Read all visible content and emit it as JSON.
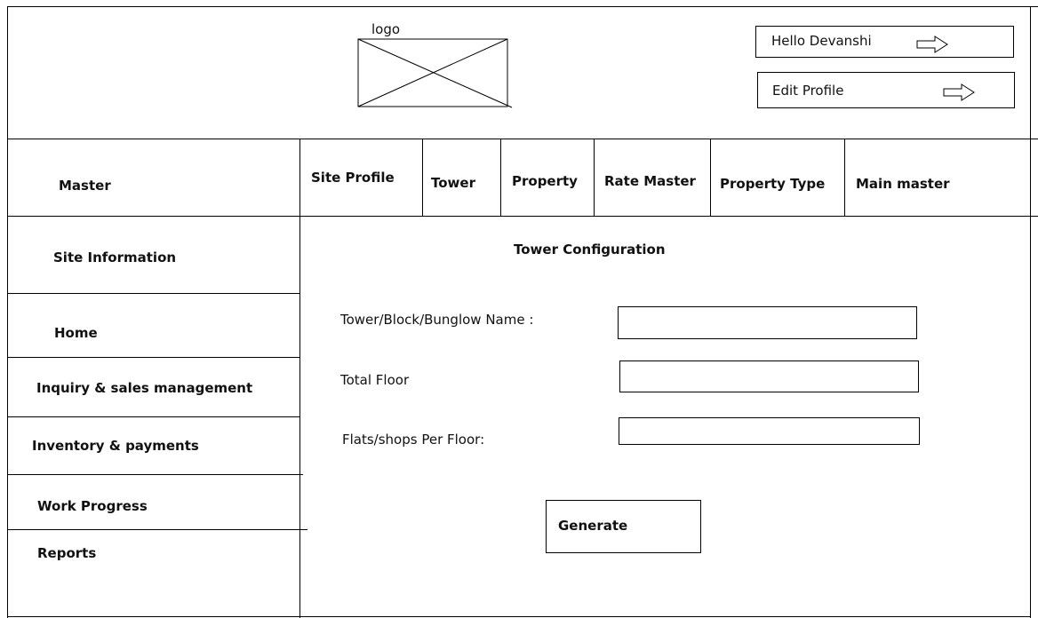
{
  "header": {
    "logo_label": "logo",
    "greeting": "Hello Devanshi",
    "edit_profile": "Edit Profile",
    "arrow_icon": "arrow-right-icon"
  },
  "top_nav": {
    "master_label": "Master",
    "tabs": [
      {
        "label": "Site Profile"
      },
      {
        "label": "Tower"
      },
      {
        "label": "Property"
      },
      {
        "label": "Rate Master"
      },
      {
        "label": "Property Type"
      },
      {
        "label": "Main master"
      }
    ]
  },
  "sidebar": {
    "items": [
      {
        "label": "Site Information"
      },
      {
        "label": "Home"
      },
      {
        "label": "Inquiry & sales management"
      },
      {
        "label": "Inventory & payments"
      },
      {
        "label": "Work Progress"
      },
      {
        "label": "Reports"
      }
    ]
  },
  "form": {
    "title": "Tower Configuration",
    "fields": [
      {
        "label": "Tower/Block/Bunglow Name :",
        "value": ""
      },
      {
        "label": "Total Floor",
        "value": ""
      },
      {
        "label": "Flats/shops Per Floor:",
        "value": ""
      }
    ],
    "generate_label": "Generate"
  }
}
